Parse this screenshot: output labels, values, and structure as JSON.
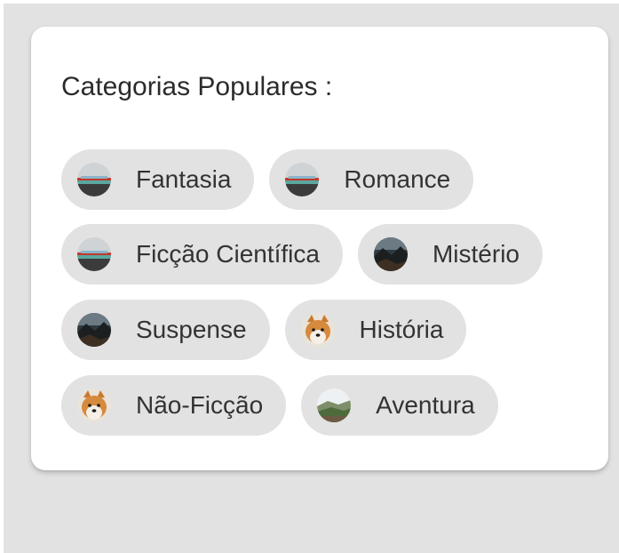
{
  "card": {
    "title": "Categorias Populares :"
  },
  "chips": [
    {
      "label": "Fantasia",
      "image": "beach-photo"
    },
    {
      "label": "Romance",
      "image": "beach-photo"
    },
    {
      "label": "Ficção Científica",
      "image": "beach-photo"
    },
    {
      "label": "Mistério",
      "image": "dark-landscape-photo"
    },
    {
      "label": "Suspense",
      "image": "dark-landscape-photo"
    },
    {
      "label": "História",
      "image": "shiba-dog-photo"
    },
    {
      "label": "Não-Ficção",
      "image": "shiba-dog-photo"
    },
    {
      "label": "Aventura",
      "image": "valley-landscape-photo"
    }
  ],
  "colors": {
    "page_background": "#e2e2e2",
    "card_background": "#ffffff",
    "chip_background": "#e2e2e2",
    "text": "#333333"
  }
}
